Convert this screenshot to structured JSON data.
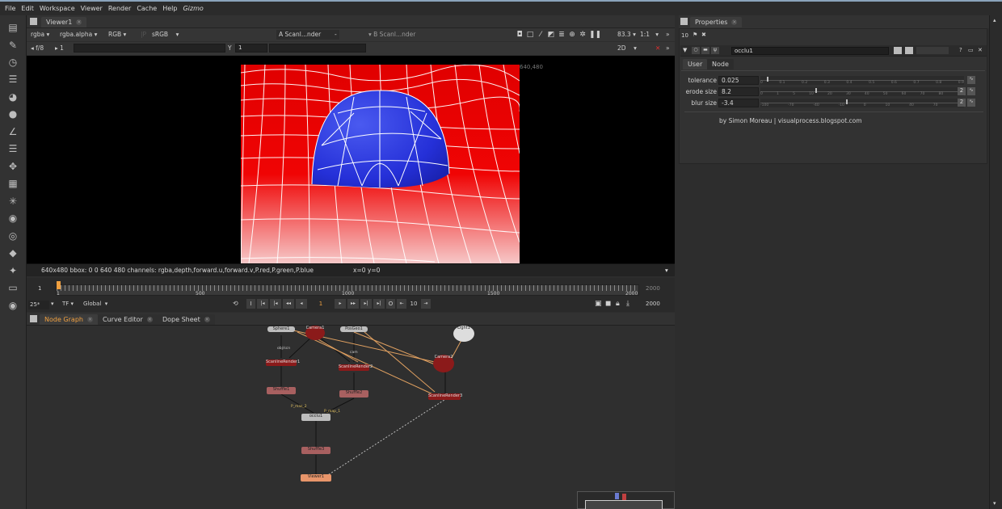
{
  "menu": [
    "File",
    "Edit",
    "Workspace",
    "Viewer",
    "Render",
    "Cache",
    "Help",
    "Gizmo"
  ],
  "viewer": {
    "tab": "Viewer1",
    "channels": "rgba",
    "alpha": "rgba.alpha",
    "display": "RGB",
    "lut": "sRGB",
    "input_a": "A  Scanl...nder",
    "input_a_op": "-",
    "input_b": "B  Scanl...nder",
    "zoom": "83.3",
    "ratio": "1:1",
    "fstop": "f/8",
    "frame": "1",
    "y_label": "Y",
    "y_value": "1",
    "view_mode": "2D",
    "format_label": "640,480",
    "status": "640x480  bbox: 0 0 640 480 channels: rgba,depth,forward.u,forward.v,P.red,P.green,P.blue",
    "coords": "x=0 y=0"
  },
  "timeline": {
    "ticks": [
      "1",
      "500",
      "1000",
      "1500",
      "2000"
    ],
    "start": "1",
    "end": "2000",
    "end2": "2000",
    "fps": "25*",
    "tf": "TF",
    "range": "Global",
    "current_frame": "1",
    "step": "10"
  },
  "graph_tabs": [
    "Node Graph",
    "Curve Editor",
    "Dope Sheet"
  ],
  "nodes": {
    "sphere": "Sphere1",
    "posgeo": "PosGeo1",
    "light": "Light1",
    "camera1": "Camera1",
    "camera2": "Camera2",
    "occlu": "occlu1",
    "viewer": "Viewer1",
    "shuffle1": "Shuffle1",
    "shuffle2": "Shuffle2",
    "shuffle3": "Shuffle3",
    "scan1": "ScanlineRender1",
    "scan2": "ScanlineRender2",
    "scan3": "ScanlineRender3",
    "pin_p1": "P_mas_2",
    "pin_p2": "P_map_1",
    "lbl_obj": "obj/scn",
    "lbl_cam": "cam"
  },
  "properties": {
    "tab": "Properties",
    "count": "10",
    "node_name": "occlu1",
    "tabs": [
      "User",
      "Node"
    ],
    "knobs": [
      {
        "label": "tolerance",
        "value": "0.025",
        "ticks": [
          "0",
          "0.1",
          "0.2",
          "0.3",
          "0.4",
          "0.5",
          "0.6",
          "0.7",
          "0.8",
          "0.9"
        ],
        "pos": 0.03
      },
      {
        "label": "erode size",
        "value": "8.2",
        "ticks": [
          "0",
          "1",
          "5",
          "10",
          "20",
          "30",
          "40",
          "50",
          "60",
          "70",
          "80",
          "100"
        ],
        "pos": 0.27
      },
      {
        "label": "blur size",
        "value": "-3.4",
        "ticks": [
          "-100",
          "-70",
          "-40",
          "-10",
          "0",
          "10",
          "40",
          "70",
          "100"
        ],
        "pos": 0.42
      }
    ],
    "channel_badge": "2",
    "credit": "by Simon Moreau | visualprocess.blogspot.com"
  },
  "colors": {
    "accent": "#f0a040",
    "node_red": "#8b1a1a",
    "viewer_node": "#e8956a",
    "link_orange": "#d99a5a"
  }
}
